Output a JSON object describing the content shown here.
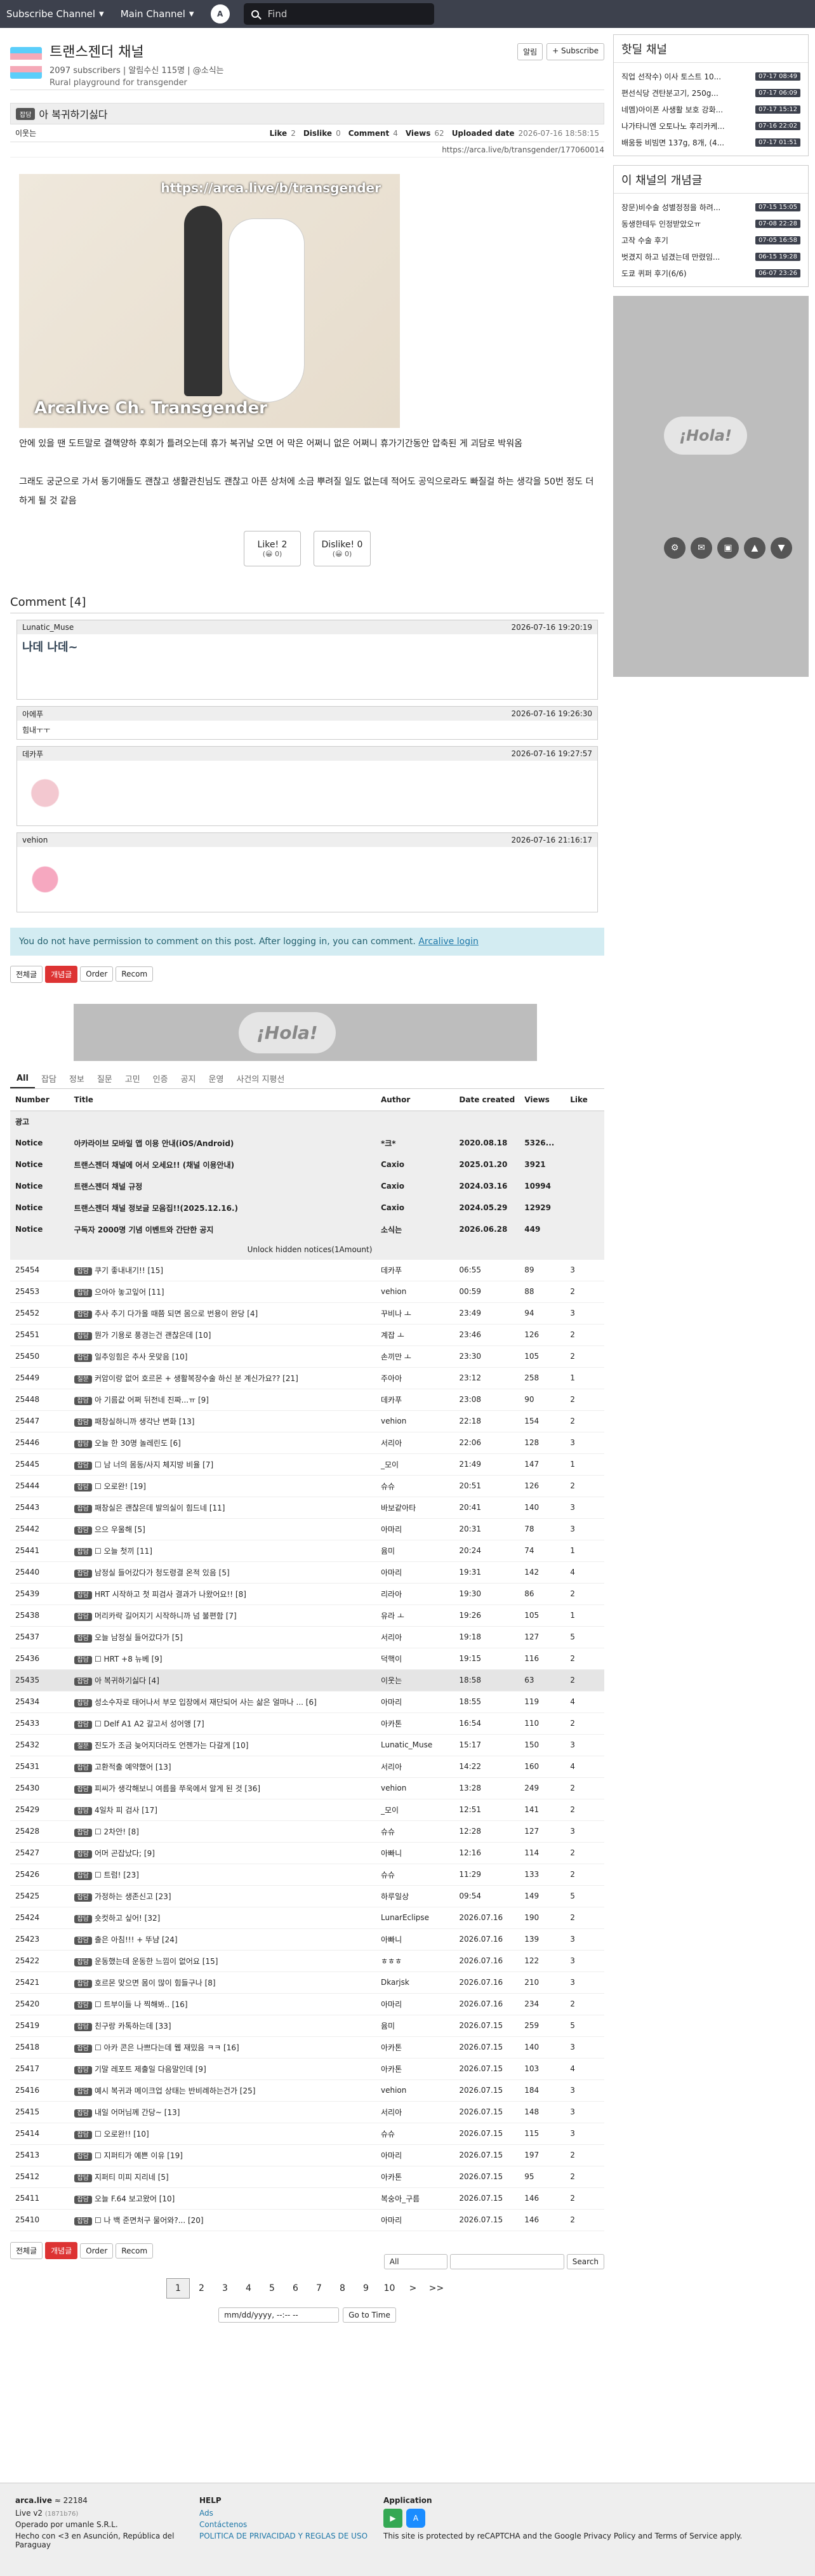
{
  "topbar": {
    "subscribe": "Subscribe Channel",
    "main": "Main Channel",
    "search": "Find"
  },
  "channel": {
    "title": "트랜스젠더 채널",
    "meta": "2097 subscribers | 알림수신 115명 | @소식는",
    "desc": "Rural playground for transgender",
    "alarm": "알림",
    "subscribe": "+ Subscribe"
  },
  "article": {
    "tag": "잡담",
    "title": "아 복귀하기싫다",
    "author": "이웃는",
    "like_label": "Like",
    "like": "2",
    "dislike_label": "Dislike",
    "dislike": "0",
    "comment_label": "Comment",
    "comment": "4",
    "views_label": "Views",
    "views": "62",
    "uploaded_label": "Uploaded date",
    "uploaded": "2026-07-16 18:58:15",
    "url": "https://arca.live/b/transgender/177060014",
    "wm1": "https://arca.live/b/transgender",
    "wm2": "Arcalive Ch. Transgender",
    "p1": "안에 있을 땐 도트말로 결핵양하 후회가 틀려오는데 휴가 복귀날 오면 어 막은 어쩌니 없은 어쩌니 휴가기간동안 압축된 게 괴담로 박워옴",
    "p2": "그래도 궁군으로 가서 동기애들도 괜찮고 생활관친님도 괜찮고 아픈 상처에 소금 뿌려질 일도 없는데 적어도 공익으로라도 빠질걸 하는 생각을 50번 정도 더 하게 될 것 같음",
    "like_btn": "Like! 2",
    "like_sub": "(😀 0)",
    "dislike_btn": "Dislike! 0",
    "dislike_sub": "(😀 0)"
  },
  "comments": {
    "title": "Comment [4]",
    "items": [
      {
        "user": "Lunatic_Muse",
        "time": "2026-07-16 19:20:19",
        "sticker": "나데 나데~"
      },
      {
        "user": "아에푸",
        "time": "2026-07-16 19:26:30",
        "text": "힘내ㅜㅜ"
      },
      {
        "user": "데카푸",
        "time": "2026-07-16 19:27:57"
      },
      {
        "user": "vehion",
        "time": "2026-07-16 21:16:17"
      }
    ]
  },
  "notice": {
    "text": "You do not have permission to comment on this post. After logging in, you can comment.",
    "link": "Arcalive login"
  },
  "filters": [
    "전체글",
    "개념글",
    "Order",
    "Recom"
  ],
  "banner": "¡Hola!",
  "tabs": [
    "All",
    "잡담",
    "정보",
    "질문",
    "고민",
    "인증",
    "공지",
    "운영",
    "사건의 지평선"
  ],
  "table": {
    "headers": [
      "Number",
      "Title",
      "Author",
      "Date created",
      "Views",
      "Like"
    ],
    "ad": "광고",
    "notices": [
      [
        "Notice",
        "아카라이브 모바일 앱 이용 안내(iOS/Android)",
        "*크*",
        "2020.08.18",
        "5326...",
        ""
      ],
      [
        "Notice",
        "트랜스젠더 채널에 어서 오세요!! (채널 이용안내)",
        "Caxio",
        "2025.01.20",
        "3921",
        ""
      ],
      [
        "Notice",
        "트랜스젠더 채널 규정",
        "Caxio",
        "2024.03.16",
        "10994",
        ""
      ],
      [
        "Notice",
        "트랜스젠더 채널 정보글 모음집!!(2025.12.16.)",
        "Caxio",
        "2024.05.29",
        "12929",
        ""
      ],
      [
        "Notice",
        "구독자 2000명 기념 이벤트와 간단한 공지",
        "소식는",
        "2026.06.28",
        "449",
        ""
      ]
    ],
    "unlock": "Unlock hidden notices(1Amount)",
    "rows": [
      [
        "25454",
        "잡담",
        "쿠기 좋내내기!! [15]",
        "데카푸",
        "06:55",
        "89",
        "3"
      ],
      [
        "25453",
        "잡담",
        "으아아 놓고잎어 [11]",
        "vehion",
        "00:59",
        "88",
        "2"
      ],
      [
        "25452",
        "잡담",
        "추사 추기 다가올 때쯤 되면 몸으로 번용이 완당 [4]",
        "꾸비나 ㅗ",
        "23:49",
        "94",
        "3"
      ],
      [
        "25451",
        "잡담",
        "뭔가 기용로 풍경는건 괜찮은데 [10]",
        "계잡 ㅗ",
        "23:46",
        "126",
        "2"
      ],
      [
        "25450",
        "잡담",
        "일추잉힘은 추사 웃맞음 [10]",
        "손끼만 ㅗ",
        "23:30",
        "105",
        "2"
      ],
      [
        "25449",
        "질문",
        "커암이랑 없어 호르몬 + 생활복장수술 하신 분 계신가요?? [21]",
        "주아아",
        "23:12",
        "258",
        "1"
      ],
      [
        "25448",
        "잡담",
        "아 기름값 어쩌 뒤전네 진짜...ㅠ [9]",
        "데카푸",
        "23:08",
        "90",
        "2"
      ],
      [
        "25447",
        "잡담",
        "패창실하니까 생각난 변화 [13]",
        "vehion",
        "22:18",
        "154",
        "2"
      ],
      [
        "25446",
        "잡담",
        "오늘 한 30명 놀레린도 [6]",
        "서리아",
        "22:06",
        "128",
        "3"
      ],
      [
        "25445",
        "잡담",
        "☐ 남 너의 몸동/사지 체지방 비율 [7]",
        "_모이",
        "21:49",
        "147",
        "1"
      ],
      [
        "25444",
        "잡담",
        "☐ 오로완! [19]",
        "슈슈",
        "20:51",
        "126",
        "2"
      ],
      [
        "25443",
        "잡담",
        "패창실은 괜찮은데 발의실이 힘드네 [11]",
        "바보같아타",
        "20:41",
        "140",
        "3"
      ],
      [
        "25442",
        "잡담",
        "으으 우울해 [5]",
        "아마리",
        "20:31",
        "78",
        "3"
      ],
      [
        "25441",
        "잡담",
        "☐ 오늘 첫끼 [11]",
        "윰미",
        "20:24",
        "74",
        "1"
      ],
      [
        "25440",
        "잡담",
        "남정실 들어갔다가 청도령결 온적 있음 [5]",
        "아마리",
        "19:31",
        "142",
        "4"
      ],
      [
        "25439",
        "잡담",
        "HRT 시작하고 첫 피검사 결과가 나왔어요!! [8]",
        "리라아",
        "19:30",
        "86",
        "2"
      ],
      [
        "25438",
        "잡담",
        "머리카락 길어지기 시작하니까 넘 불편함 [7]",
        "유라 ㅗ",
        "19:26",
        "105",
        "1"
      ],
      [
        "25437",
        "잡담",
        "오늘 남정실 들어갔다가 [5]",
        "서리아",
        "19:18",
        "127",
        "5"
      ],
      [
        "25436",
        "잡담",
        "☐ HRT +8 뉴베 [9]",
        "덕핵이",
        "19:15",
        "116",
        "2"
      ],
      [
        "25435",
        "잡담",
        "아 복귀하기싫다 [4]",
        "이웃는",
        "18:58",
        "63",
        "2"
      ],
      [
        "25434",
        "잡담",
        "성소수자로 태어나서 부모 입장에서 재단되어 사는 삶은 얼마나 ... [6]",
        "아마리",
        "18:55",
        "119",
        "4"
      ],
      [
        "25433",
        "잡담",
        "☐ Delf A1 A2 갈고서 성어앵 [7]",
        "아카톤",
        "16:54",
        "110",
        "2"
      ],
      [
        "25432",
        "질문",
        "진도가 조금 늦어지더라도 언젠가는 다갈게 [10]",
        "Lunatic_Muse",
        "15:17",
        "150",
        "3"
      ],
      [
        "25431",
        "잡담",
        "고환적출 예약했어 [13]",
        "서리아",
        "14:22",
        "160",
        "4"
      ],
      [
        "25430",
        "잡담",
        "피씨가 생각해보니 여름을 쭈욱에서 알게 된 것 [36]",
        "vehion",
        "13:28",
        "249",
        "2"
      ],
      [
        "25429",
        "잡담",
        "4일차 피 검사 [17]",
        "_모이",
        "12:51",
        "141",
        "2"
      ],
      [
        "25428",
        "잡담",
        "☐ 2차안! [8]",
        "슈슈",
        "12:28",
        "127",
        "3"
      ],
      [
        "25427",
        "잡담",
        "어머 곤잡났다; [9]",
        "아빠니",
        "12:16",
        "114",
        "2"
      ],
      [
        "25426",
        "잡담",
        "☐ 트럼! [23]",
        "슈슈",
        "11:29",
        "133",
        "2"
      ],
      [
        "25425",
        "잡담",
        "가정하는 생존신고 [23]",
        "하루일상",
        "09:54",
        "149",
        "5"
      ],
      [
        "25424",
        "잡담",
        "숏컷하고 싶어! [32]",
        "LunarEclipse",
        "2026.07.16",
        "190",
        "2"
      ],
      [
        "25423",
        "잡담",
        "출은 아침!!! + 뚜냠 [24]",
        "아빠니",
        "2026.07.16",
        "139",
        "3"
      ],
      [
        "25422",
        "잡담",
        "운동했는데 운동한 느낌이 없어요 [15]",
        "ㅎㅎㅎ",
        "2026.07.16",
        "122",
        "3"
      ],
      [
        "25421",
        "잡담",
        "호르몬 맞으면 몸이 많이 힘들구나 [8]",
        "Dkarjsk",
        "2026.07.16",
        "210",
        "3"
      ],
      [
        "25420",
        "잡담",
        "☐ 트부이들 나 찍해봐.. [16]",
        "아마리",
        "2026.07.16",
        "234",
        "2"
      ],
      [
        "25419",
        "잡담",
        "친구랑 카톡하는데 [33]",
        "윰미",
        "2026.07.15",
        "259",
        "5"
      ],
      [
        "25418",
        "잡담",
        "☐ 아카 콘은 나쁘다는데 웹 재밌음 ㅋㅋ [16]",
        "아카톤",
        "2026.07.15",
        "140",
        "3"
      ],
      [
        "25417",
        "잡담",
        "기말 레포트 제출일 다음말인데 [9]",
        "아카톤",
        "2026.07.15",
        "103",
        "4"
      ],
      [
        "25416",
        "잡담",
        "예시 복귀과 메이크업 상태는 반비례하는건가 [25]",
        "vehion",
        "2026.07.15",
        "184",
        "3"
      ],
      [
        "25415",
        "잡담",
        "내일 어머님께 간당~ [13]",
        "서리아",
        "2026.07.15",
        "148",
        "3"
      ],
      [
        "25414",
        "잡담",
        "☐ 오로완!! [10]",
        "슈슈",
        "2026.07.15",
        "115",
        "3"
      ],
      [
        "25413",
        "잡담",
        "☐ 지퍼티가 예쁜 이유 [19]",
        "아마리",
        "2026.07.15",
        "197",
        "2"
      ],
      [
        "25412",
        "잡담",
        "지퍼티 미피 지리네 [5]",
        "아카톤",
        "2026.07.15",
        "95",
        "2"
      ],
      [
        "25411",
        "잡담",
        "오늘 F.64 보고왔어 [10]",
        "복숭아_구름",
        "2026.07.15",
        "146",
        "2"
      ],
      [
        "25410",
        "잡담",
        "☐ 나 백 준면처구 물어와?... [20]",
        "아마리",
        "2026.07.15",
        "146",
        "2"
      ]
    ]
  },
  "bottom_filters": [
    "전체글",
    "개념글",
    "Order",
    "Recom"
  ],
  "searchbar": {
    "select": "All",
    "button": "Search"
  },
  "pager": [
    "1",
    "2",
    "3",
    "4",
    "5",
    "6",
    "7",
    "8",
    "9",
    "10",
    ">",
    ">>"
  ],
  "dategoto": {
    "placeholder": "mm/dd/yyyy, --:-- --",
    "button": "Go to Time"
  },
  "footer": {
    "brand": "arca.live",
    "count": "≈ 22184",
    "ver": "Live v2",
    "hash": "(1871b76)",
    "op": "Operado por umanle S.R.L.",
    "made": "Hecho con <3 en Asunción, República del Paraguay",
    "help": "HELP",
    "ads": "Ads",
    "contact": "Contáctenos",
    "policy": "POLITICA DE PRIVACIDAD Y REGLAS DE USO",
    "app": "Application",
    "recaptcha": "This site is protected by reCAPTCHA and the Google Privacy Policy and Terms of Service apply."
  },
  "side": {
    "hot_title": "핫딜 채널",
    "hot": [
      [
        "직업 선작수) 이사 토스트 10...",
        "07-17 08:49"
      ],
      [
        "편선식당 견탄분고기, 250g...",
        "07-17 06:09"
      ],
      [
        "네멤)아이폰 사생활 보호 강화...",
        "07-17 15:12"
      ],
      [
        "나가타니엔 오토나노 후리카케...",
        "07-16 22:02"
      ],
      [
        "배움등 비빔면 137g, 8개, (4...",
        "07-17 01:51"
      ]
    ],
    "concept_title": "이 채널의 개념글",
    "concept": [
      [
        "장문)비수술 성별정정을 하려...",
        "07-15 15:05"
      ],
      [
        "동생한테두 인정받았오ㅠ",
        "07-08 22:28"
      ],
      [
        "고작 수술 후기",
        "07-05 16:58"
      ],
      [
        "벗겼지 하고 넘겼는데 만렸임...",
        "06-15 19:28"
      ],
      [
        "도쿄 퀴퍼 후기(6/6)",
        "06-07 23:26"
      ]
    ],
    "ad_text": "¡Hola!"
  }
}
